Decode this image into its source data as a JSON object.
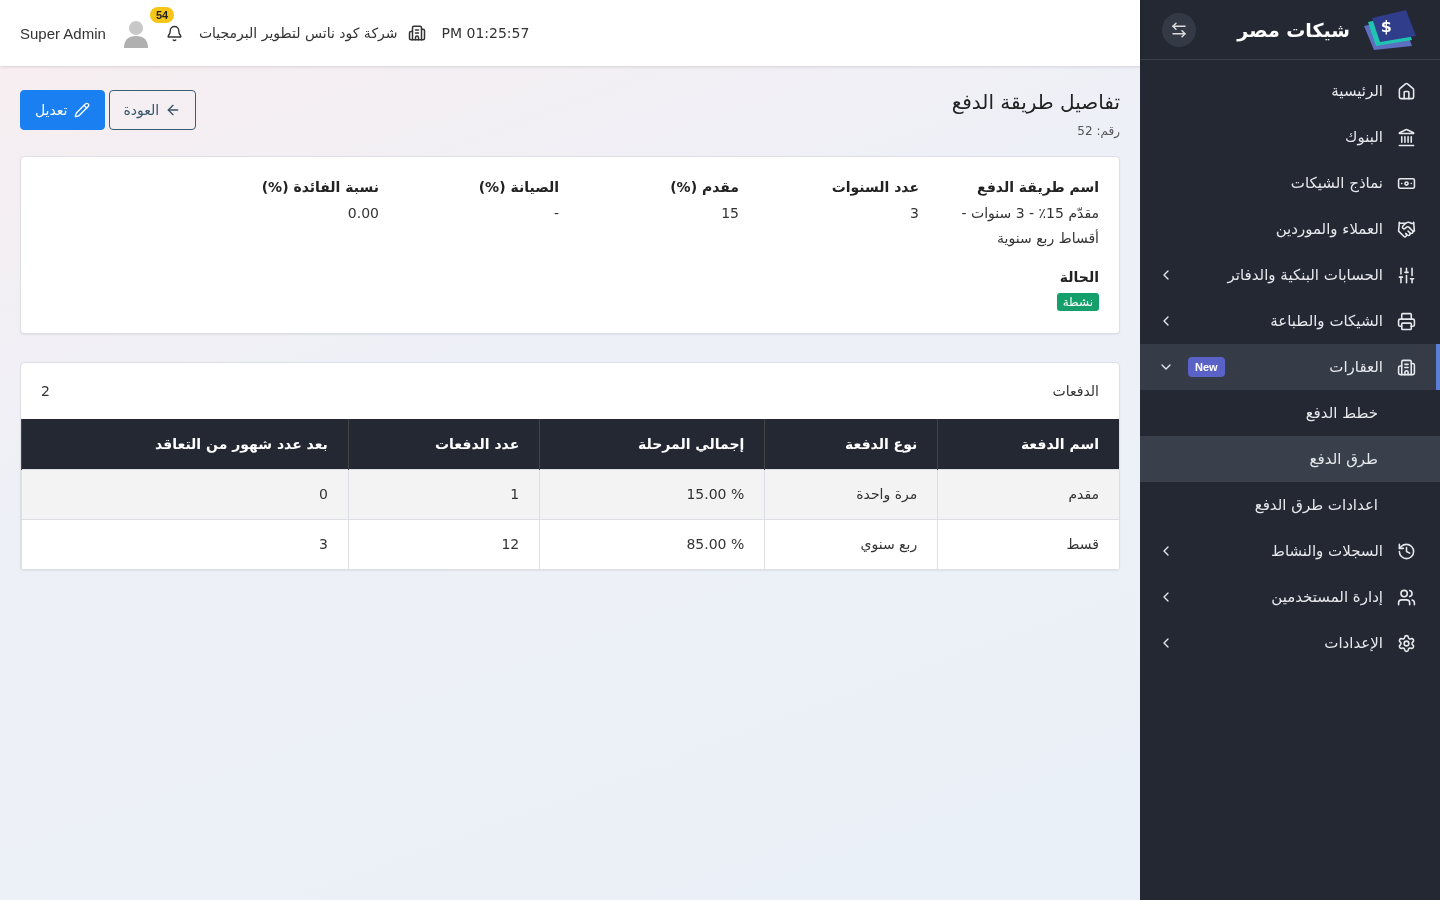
{
  "header": {
    "clock": "PM 01:25:57",
    "company": "شركة كود ناتس لتطوير البرمجيات",
    "notifications": "54",
    "user": "Super Admin"
  },
  "sidebar": {
    "brand": "شيكات مصر",
    "logo_symbol": "$",
    "items": [
      {
        "label": "الرئيسية",
        "kind": "link",
        "selected": false
      },
      {
        "label": "البنوك",
        "kind": "link",
        "selected": false
      },
      {
        "label": "نماذج الشيكات",
        "kind": "link",
        "selected": false
      },
      {
        "label": "العملاء والموردين",
        "kind": "link",
        "selected": false
      },
      {
        "label": "الحسابات البنكية والدفاتر",
        "kind": "group",
        "selected": false,
        "expanded": false
      },
      {
        "label": "الشيكات والطباعة",
        "kind": "group",
        "selected": false,
        "expanded": false
      },
      {
        "label": "العقارات",
        "kind": "group",
        "selected": true,
        "expanded": true,
        "badge": "New",
        "children": [
          {
            "label": "خطط الدفع",
            "selected": false
          },
          {
            "label": "طرق الدفع",
            "selected": true
          },
          {
            "label": "اعدادات طرق الدفع",
            "selected": false
          }
        ]
      },
      {
        "label": "السجلات والنشاط",
        "kind": "group",
        "selected": false,
        "expanded": false
      },
      {
        "label": "إدارة المستخدمين",
        "kind": "group",
        "selected": false,
        "expanded": false
      },
      {
        "label": "الإعدادات",
        "kind": "group",
        "selected": false,
        "expanded": false
      }
    ]
  },
  "page": {
    "title": "تفاصيل طريقة الدفع",
    "number": "رقم: 52",
    "buttons": [
      {
        "label": "العودة",
        "kind": "outline"
      },
      {
        "label": "تعديل",
        "kind": "primary"
      }
    ]
  },
  "details": {
    "fields": [
      {
        "label": "اسم طريقة الدفع",
        "value": "مقدّم 15٪ - 3 سنوات - أقساط ربع سنوية"
      },
      {
        "label": "عدد السنوات",
        "value": "3"
      },
      {
        "label": "مقدم (%)",
        "value": "15"
      },
      {
        "label": "الصيانة (%)",
        "value": "-"
      },
      {
        "label": "نسبة الفائدة (%)",
        "value": "0.00"
      }
    ],
    "status": {
      "label": "الحالة",
      "value": "نشطة",
      "active": true
    }
  },
  "payments": {
    "title": "الدفعات",
    "count": "2",
    "columns": [
      "اسم الدفعة",
      "نوع الدفعة",
      "إجمالي المرحلة",
      "عدد الدفعات",
      "بعد عدد شهور من التعاقد"
    ],
    "rows": [
      [
        "مقدم",
        "مرة واحدة",
        "% 15.00",
        "1",
        "0"
      ],
      [
        "قسط",
        "ربع سنوي",
        "% 85.00",
        "12",
        "3"
      ]
    ]
  }
}
